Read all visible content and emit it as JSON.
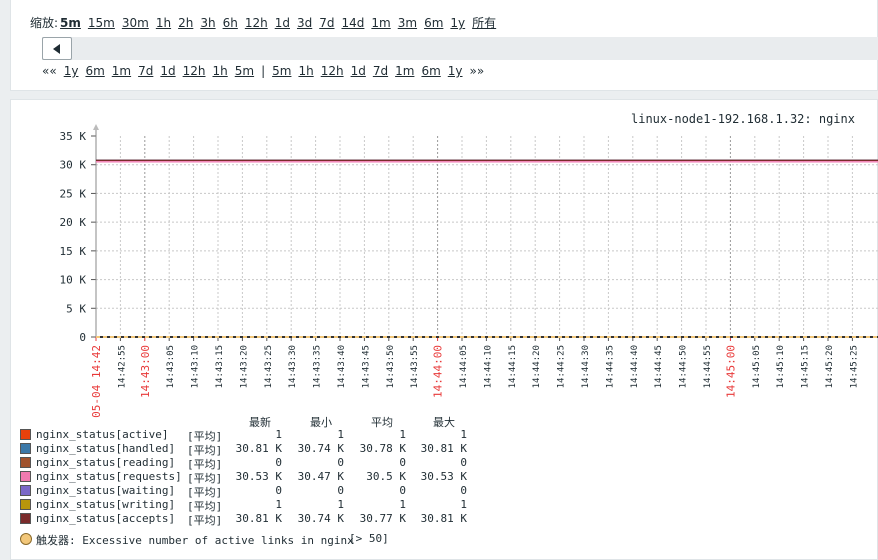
{
  "filter": {
    "zoom_label": "缩放:",
    "zoom_options": [
      "5m",
      "15m",
      "30m",
      "1h",
      "2h",
      "3h",
      "6h",
      "12h",
      "1d",
      "3d",
      "7d",
      "14d",
      "1m",
      "3m",
      "6m",
      "1y",
      "所有"
    ],
    "zoom_active": "5m",
    "nav_prev_arrow": "««",
    "nav_back": [
      "1y",
      "6m",
      "1m",
      "7d",
      "1d",
      "12h",
      "1h",
      "5m"
    ],
    "nav_separator": "|",
    "nav_forward": [
      "5m",
      "1h",
      "12h",
      "1d",
      "7d",
      "1m",
      "6m",
      "1y"
    ],
    "nav_next_arrow": "»»"
  },
  "graph": {
    "title": "linux-node1-192.168.1.32: nginx",
    "trigger": {
      "label": "触发器: Excessive number of active links in nginx",
      "threshold": "[> 50]"
    }
  },
  "chart_data": {
    "type": "line",
    "y_ticks": [
      "35 K",
      "30 K",
      "25 K",
      "20 K",
      "15 K",
      "10 K",
      "5 K",
      "0"
    ],
    "ylim": [
      0,
      35000
    ],
    "x_ticks": [
      {
        "label": "05-04 14:42",
        "major": true
      },
      {
        "label": "14:42:55",
        "major": false
      },
      {
        "label": "14:43:00",
        "major": true
      },
      {
        "label": "14:43:05",
        "major": false
      },
      {
        "label": "14:43:10",
        "major": false
      },
      {
        "label": "14:43:15",
        "major": false
      },
      {
        "label": "14:43:20",
        "major": false
      },
      {
        "label": "14:43:25",
        "major": false
      },
      {
        "label": "14:43:30",
        "major": false
      },
      {
        "label": "14:43:35",
        "major": false
      },
      {
        "label": "14:43:40",
        "major": false
      },
      {
        "label": "14:43:45",
        "major": false
      },
      {
        "label": "14:43:50",
        "major": false
      },
      {
        "label": "14:43:55",
        "major": false
      },
      {
        "label": "14:44:00",
        "major": true
      },
      {
        "label": "14:44:05",
        "major": false
      },
      {
        "label": "14:44:10",
        "major": false
      },
      {
        "label": "14:44:15",
        "major": false
      },
      {
        "label": "14:44:20",
        "major": false
      },
      {
        "label": "14:44:25",
        "major": false
      },
      {
        "label": "14:44:30",
        "major": false
      },
      {
        "label": "14:44:35",
        "major": false
      },
      {
        "label": "14:44:40",
        "major": false
      },
      {
        "label": "14:44:45",
        "major": false
      },
      {
        "label": "14:44:50",
        "major": false
      },
      {
        "label": "14:44:55",
        "major": false
      },
      {
        "label": "14:45:00",
        "major": true
      },
      {
        "label": "14:45:05",
        "major": false
      },
      {
        "label": "14:45:10",
        "major": false
      },
      {
        "label": "14:45:15",
        "major": false
      },
      {
        "label": "14:45:20",
        "major": false
      },
      {
        "label": "14:45:25",
        "major": false
      }
    ],
    "legend_headers": [
      "最新",
      "最小",
      "平均",
      "最大"
    ],
    "series": [
      {
        "name": "nginx_status[active]",
        "color": "#e8410c",
        "func": "[平均]",
        "last": "1",
        "min": "1",
        "avg": "1",
        "max": "1",
        "value": 1
      },
      {
        "name": "nginx_status[handled]",
        "color": "#3b78a8",
        "func": "[平均]",
        "last": "30.81 K",
        "min": "30.74 K",
        "avg": "30.78 K",
        "max": "30.81 K",
        "value": 30780
      },
      {
        "name": "nginx_status[reading]",
        "color": "#a0522d",
        "func": "[平均]",
        "last": "0",
        "min": "0",
        "avg": "0",
        "max": "0",
        "value": 0
      },
      {
        "name": "nginx_status[requests]",
        "color": "#f07ab0",
        "func": "[平均]",
        "last": "30.53 K",
        "min": "30.47 K",
        "avg": "30.5 K",
        "max": "30.53 K",
        "value": 30500
      },
      {
        "name": "nginx_status[waiting]",
        "color": "#7b68c8",
        "func": "[平均]",
        "last": "0",
        "min": "0",
        "avg": "0",
        "max": "0",
        "value": 0
      },
      {
        "name": "nginx_status[writing]",
        "color": "#b8960c",
        "func": "[平均]",
        "last": "1",
        "min": "1",
        "avg": "1",
        "max": "1",
        "value": 1
      },
      {
        "name": "nginx_status[accepts]",
        "color": "#7a2b2b",
        "func": "[平均]",
        "last": "30.81 K",
        "min": "30.74 K",
        "avg": "30.77 K",
        "max": "30.81 K",
        "value": 30770
      }
    ],
    "trigger_color": "#f2c77a",
    "grid": true,
    "major_tick_color": "#e83838"
  }
}
